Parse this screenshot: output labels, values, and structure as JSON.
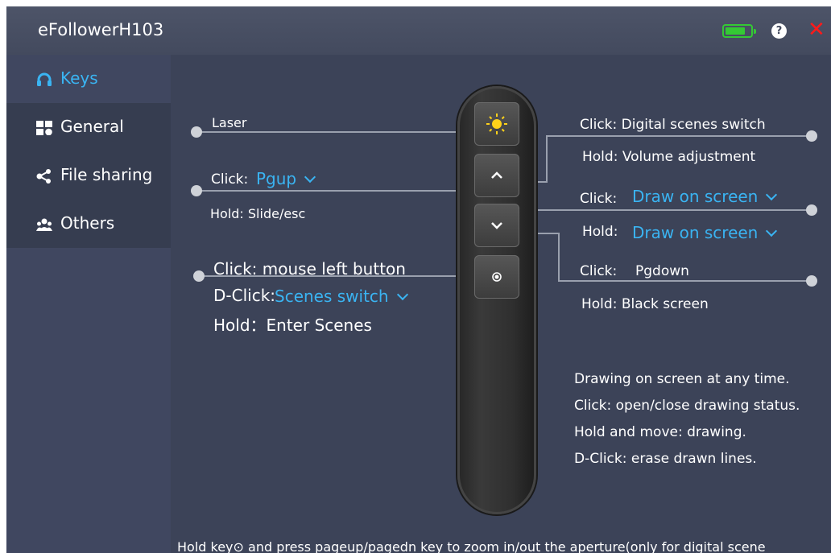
{
  "app": {
    "title": "eFollowerH103",
    "battery_level": 0.8
  },
  "sidebar": {
    "items": [
      {
        "label": "Keys",
        "icon": "headset-icon",
        "active": true
      },
      {
        "label": "General",
        "icon": "grid-icon"
      },
      {
        "label": "File sharing",
        "icon": "share-icon"
      },
      {
        "label": "Others",
        "icon": "users-icon"
      }
    ]
  },
  "keys": {
    "laser": {
      "label": "Laser"
    },
    "up": {
      "click_label": "Click:",
      "click_value": "Pgup",
      "hold_text": "Hold: Slide/esc"
    },
    "center": {
      "click_text": "Click: mouse left button",
      "dclick_label": "D-Click:",
      "dclick_value": "Scenes switch",
      "hold_text": "Hold：Enter Scenes"
    },
    "right_top": {
      "click_text": "Click:  Digital scenes switch",
      "hold_text": "Hold:  Volume adjustment"
    },
    "draw": {
      "click_label": "Click:",
      "click_value": "Draw on screen",
      "hold_label": "Hold:",
      "hold_value": "Draw on screen"
    },
    "down": {
      "click_label": "Click:",
      "click_value": "Pgdown",
      "hold_text": "Hold: Black screen"
    }
  },
  "notes": [
    "Drawing on screen at any time.",
    "Click:  open/close drawing status.",
    "Hold and move:  drawing.",
    "D-Click: erase drawn lines."
  ],
  "footer": "Hold key⊙ and press pageup/pagedn key to zoom in/out the aperture(only for digital scene",
  "colors": {
    "accent": "#3ab4f2",
    "background": "#3c4358",
    "close": "#ff1a1a",
    "battery": "#34c934"
  }
}
